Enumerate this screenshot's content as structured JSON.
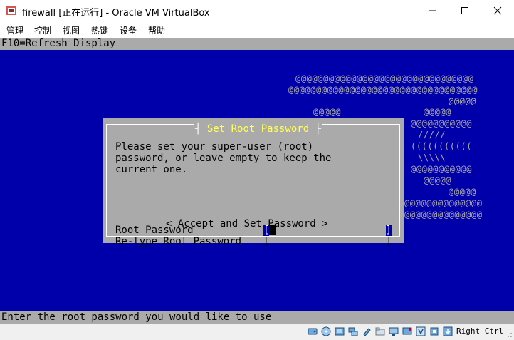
{
  "window": {
    "title": "firewall [正在运行] - Oracle VM VirtualBox",
    "icon": "virtualbox-icon",
    "controls": [
      "minimize-icon",
      "maximize-icon",
      "close-icon"
    ]
  },
  "menu": [
    {
      "label": "管理"
    },
    {
      "label": "控制"
    },
    {
      "label": "视图"
    },
    {
      "label": "热键"
    },
    {
      "label": "设备"
    },
    {
      "label": "帮助"
    }
  ],
  "console": {
    "top_line": "F10=Refresh Display",
    "bottom_line": "Enter the root password you would like to use",
    "colors": {
      "background": "#0000aa",
      "bar": "#aaaaaa",
      "title": "#ffff55",
      "logo": "#aaaaaa"
    },
    "logo_lines": [
      "@@@@@@@@@@@@@@@@@@@@@@@@@@@@@@@@",
      "@@@@@@@@@@@@@@@@@@@@@@@@@@@@@@@@@@",
      "@@@@@",
      "@@@@@",
      "@@@@@",
      "@@@@@",
      "@@@@@@@@@@@",
      "/////",
      "(((((((((((",
      "\\\\\\\\\\",
      "@@@@@@@@@@@",
      "@@@@@",
      "@@@@@",
      "@@@@@@@@@@@@@@",
      "@@@@@@@@@@@@@@"
    ]
  },
  "dialog": {
    "title": "Set Root Password",
    "message_lines": [
      "Please set your super-user (root)",
      "password, or leave empty to keep the",
      "current one."
    ],
    "fields": [
      {
        "label": "Root Password",
        "value": ""
      },
      {
        "label": "Re-type Root Password",
        "value": ""
      }
    ],
    "bracket_left": "[",
    "bracket_right": "]",
    "accept_label": "< Accept and Set Password >"
  },
  "statusbar": {
    "icons": [
      "hard-disk-icon",
      "optical-drive-icon",
      "audio-icon",
      "network-icon",
      "usb-icon",
      "shared-folders-icon",
      "display-icon",
      "video-capture-icon",
      "virtualization-icon",
      "mouse-integration-icon"
    ],
    "host_key": "Right Ctrl"
  }
}
